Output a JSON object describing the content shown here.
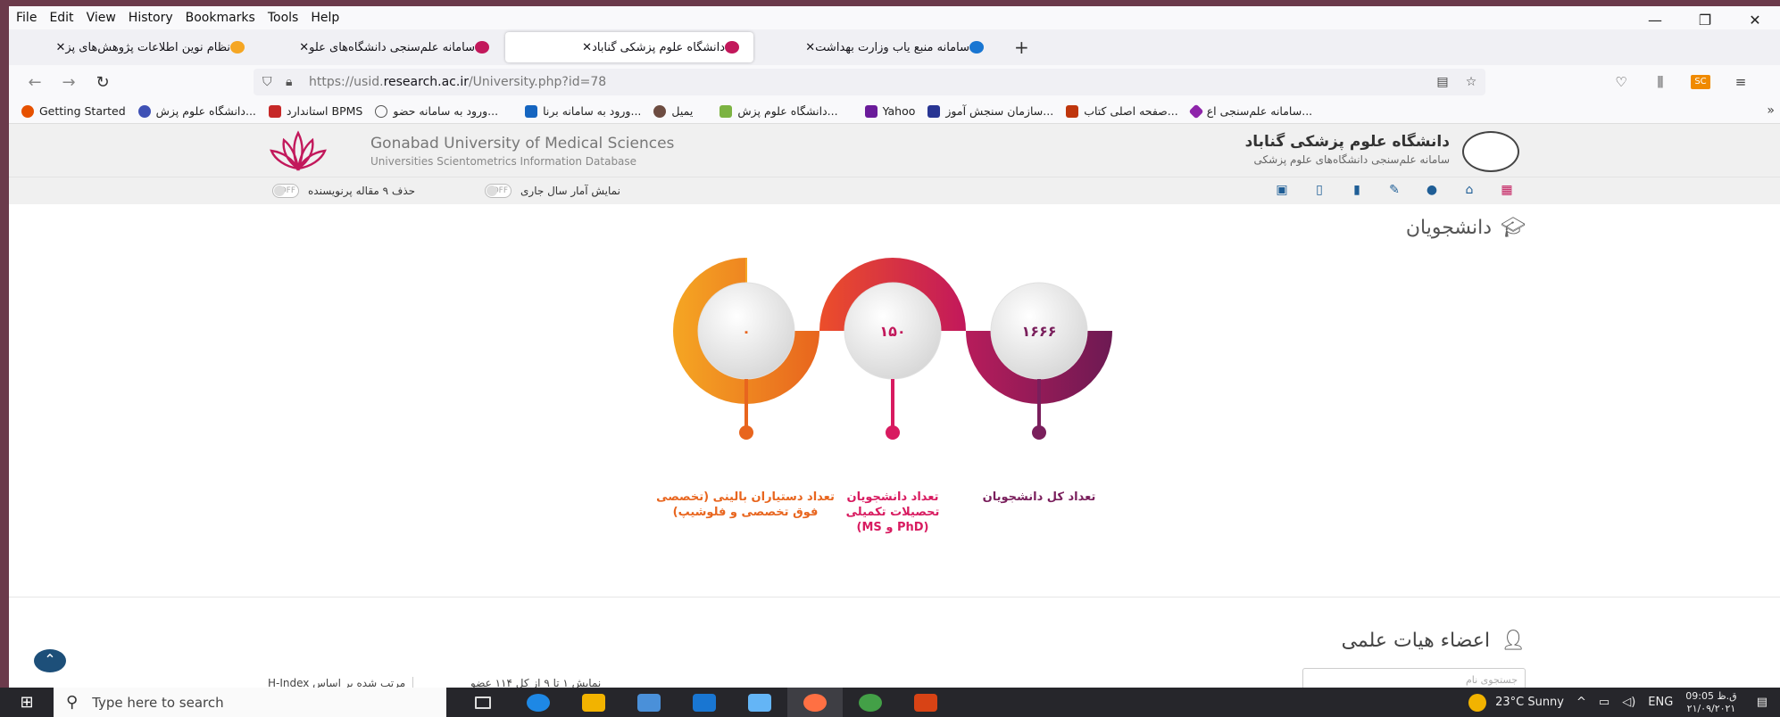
{
  "menu": [
    "File",
    "Edit",
    "View",
    "History",
    "Bookmarks",
    "Tools",
    "Help"
  ],
  "window_controls": [
    "—",
    "❐",
    "✕"
  ],
  "tabs": [
    {
      "title": "نظام نوین اطلاعات پژوهش‌های پز",
      "active": false,
      "fav": "#f5a623"
    },
    {
      "title": "سامانه علم‌سنجی دانشگاه‌های علو",
      "active": false,
      "fav": "#c2185b"
    },
    {
      "title": "دانشگاه علوم پزشکی گناباد",
      "active": true,
      "fav": "#c2185b"
    },
    {
      "title": "سامانه منبع یاب وزارت بهداشت",
      "active": false,
      "fav": "#1976d2"
    }
  ],
  "new_tab_label": "+",
  "url": {
    "prefix": "https://usid.",
    "host": "research.ac.ir",
    "path": "/University.php?id=78"
  },
  "bookmarks": [
    {
      "label": "Getting Started",
      "color": "#e65100"
    },
    {
      "label": "دانشگاه علوم پزش...",
      "color": "#3f51b5"
    },
    {
      "label": "استاندارد BPMS",
      "color": "#c62828"
    },
    {
      "label": "ورود به سامانه حضو...",
      "color": "#555"
    },
    {
      "label": "ورود به سامانه برنا...",
      "color": "#1565c0"
    },
    {
      "label": "یمیل",
      "color": "#6d4c41"
    },
    {
      "label": "دانشگاه علوم پزش...",
      "color": "#7cb342"
    },
    {
      "label": "Yahoo",
      "color": "#6a1b9a"
    },
    {
      "label": "سازمان سنجش آموز...",
      "color": "#283593"
    },
    {
      "label": "صفحه اصلی کتاب...",
      "color": "#bf360c"
    },
    {
      "label": "سامانه علم‌سنجی اع...",
      "color": "#8e24aa"
    }
  ],
  "site": {
    "name_en": "Gonabad University of Medical Sciences",
    "sub_en": "Universities Scientometrics Information Database",
    "name_fa": "دانشگاه علوم پزشکی گناباد",
    "sub_fa": "سامانه علم‌سنجی دانشگاه‌های علوم پزشکی",
    "toggle1_label": "نمایش آمار سال جاری",
    "toggle2_label": "حذف ۹ مقاله پرنویسنده",
    "toggle_state": "OFF"
  },
  "students": {
    "title": "دانشجویان",
    "stats": [
      {
        "value": "۱۶۶۶",
        "label": "تعداد کل دانشجویان",
        "color": "#7a1f5c"
      },
      {
        "value": "۱۵۰",
        "label": "تعداد دانشجویان تحصیلات تکمیلی (PhD و MS)",
        "color": "#d81b60"
      },
      {
        "value": "۰",
        "label": "تعداد دستیاران بالینی (تخصصی فوق تخصصی و فلوشیپ)",
        "color": "#e8651e"
      }
    ]
  },
  "faculty": {
    "title": "اعضاء هیات علمی",
    "search_placeholder": "جستجوی نام",
    "list_info": "نمایش ۱ تا ۹ از کل ۱۱۴ عضو",
    "sort_info": "مرتب شده بر اساس H-Index"
  },
  "taskbar": {
    "search_placeholder": "Type here to search",
    "weather": "23°C  Sunny",
    "lang": "ENG",
    "time": "ق.ظ 09:05",
    "date": "۲۱/۰۹/۲۰۲۱"
  }
}
